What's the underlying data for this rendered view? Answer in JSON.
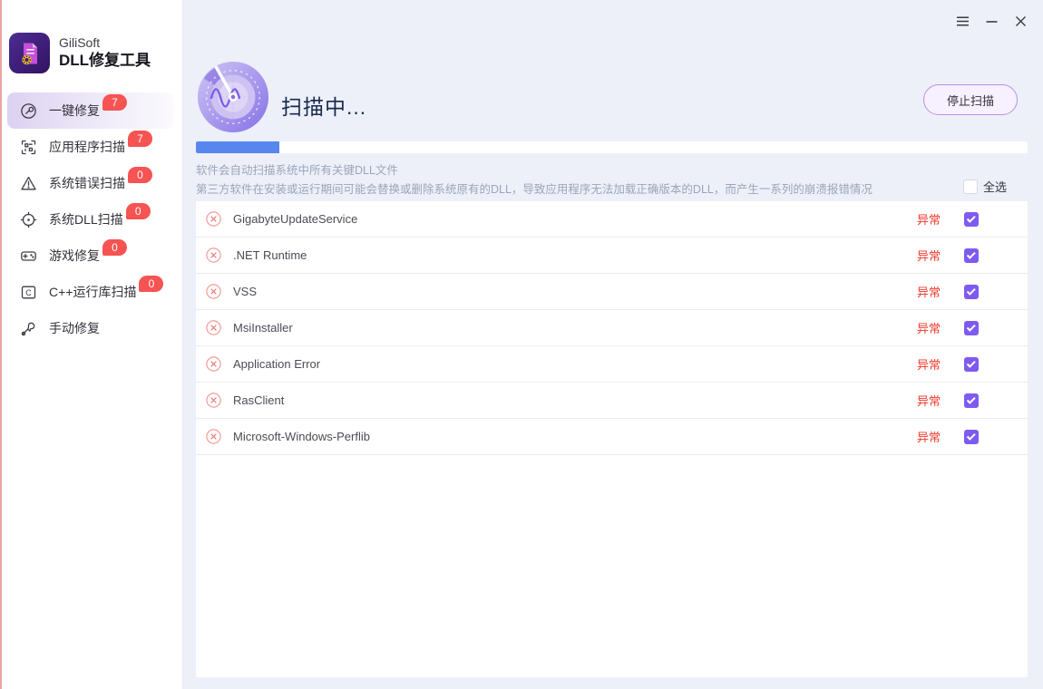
{
  "app": {
    "brand": "GiliSoft",
    "title": "DLL修复工具"
  },
  "window_controls": {
    "menu": "menu",
    "minimize": "minimize",
    "close": "close"
  },
  "sidebar": {
    "items": [
      {
        "key": "one-key-repair",
        "label": "一键修复",
        "badge": "7",
        "icon": "wrench-circle",
        "active": true
      },
      {
        "key": "app-scan",
        "label": "应用程序扫描",
        "badge": "7",
        "icon": "app-scan",
        "active": false
      },
      {
        "key": "system-error-scan",
        "label": "系统错误扫描",
        "badge": "0",
        "icon": "warning-triangle",
        "active": false
      },
      {
        "key": "system-dll-scan",
        "label": "系统DLL扫描",
        "badge": "0",
        "icon": "target",
        "active": false
      },
      {
        "key": "game-repair",
        "label": "游戏修复",
        "badge": "0",
        "icon": "gamepad",
        "active": false
      },
      {
        "key": "cpp-runtime-scan",
        "label": "C++运行库扫描",
        "badge": "0",
        "icon": "c-square",
        "active": false
      },
      {
        "key": "manual-repair",
        "label": "手动修复",
        "badge": null,
        "icon": "wrench",
        "active": false
      }
    ]
  },
  "header": {
    "title": "扫描中...",
    "stop_button_label": "停止扫描"
  },
  "progress": {
    "percent": 10
  },
  "description": {
    "line1": "软件会自动扫描系统中所有关键DLL文件",
    "line2": "第三方软件在安装或运行期间可能会替换或删除系统原有的DLL，导致应用程序无法加载正确版本的DLL，而产生一系列的崩溃报错情况"
  },
  "list": {
    "select_all_label": "全选",
    "select_all_checked": false,
    "items": [
      {
        "name": "GigabyteUpdateService",
        "status": "异常",
        "checked": true
      },
      {
        "name": ".NET Runtime",
        "status": "异常",
        "checked": true
      },
      {
        "name": "VSS",
        "status": "异常",
        "checked": true
      },
      {
        "name": "MsiInstaller",
        "status": "异常",
        "checked": true
      },
      {
        "name": "Application Error",
        "status": "异常",
        "checked": true
      },
      {
        "name": "RasClient",
        "status": "异常",
        "checked": true
      },
      {
        "name": "Microsoft-Windows-Perflib",
        "status": "异常",
        "checked": true
      }
    ]
  },
  "colors": {
    "main_bg": "#edf0f9",
    "accent_purple": "#7e5bef",
    "badge_red": "#f65353",
    "status_red": "#f2382c",
    "progress_blue": "#5787ee",
    "button_border": "#b98fe3",
    "button_bg": "#f7f0fe"
  }
}
